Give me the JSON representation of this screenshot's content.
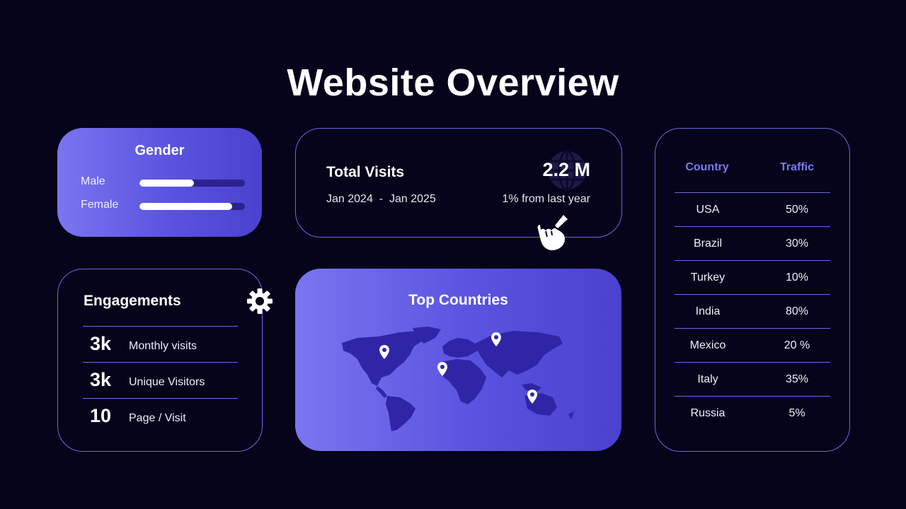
{
  "title": "Website Overview",
  "colors": {
    "background": "#05041a",
    "accent": "#6a67e6",
    "header_text": "#7f79f2",
    "bar_track": "#2a238f"
  },
  "gender": {
    "heading": "Gender",
    "rows": [
      {
        "label": "Male",
        "fill_fraction": 0.52
      },
      {
        "label": "Female",
        "fill_fraction": 0.88
      }
    ]
  },
  "visits": {
    "heading": "Total Visits",
    "range": "Jan 2024  -  Jan 2025",
    "value": "2.2 M",
    "change": "1% from last year",
    "icon": "globe-icon"
  },
  "engagements": {
    "heading": "Engagements",
    "icon": "gear-icon",
    "rows": [
      {
        "num": "3k",
        "desc": "Monthly visits"
      },
      {
        "num": "3k",
        "desc": "Unique Visitors"
      },
      {
        "num": "10",
        "desc": "Page / Visit"
      }
    ]
  },
  "top_countries": {
    "heading": "Top Countries",
    "icon": "location-pin-icon"
  },
  "country_table": {
    "headers": [
      "Country",
      "Traffic"
    ],
    "rows": [
      {
        "country": "USA",
        "traffic": "50%"
      },
      {
        "country": "Brazil",
        "traffic": "30%"
      },
      {
        "country": "Turkey",
        "traffic": "10%"
      },
      {
        "country": "India",
        "traffic": "80%"
      },
      {
        "country": "Mexico",
        "traffic": "20 %"
      },
      {
        "country": "Italy",
        "traffic": "35%"
      },
      {
        "country": "Russia",
        "traffic": "5%"
      }
    ]
  }
}
